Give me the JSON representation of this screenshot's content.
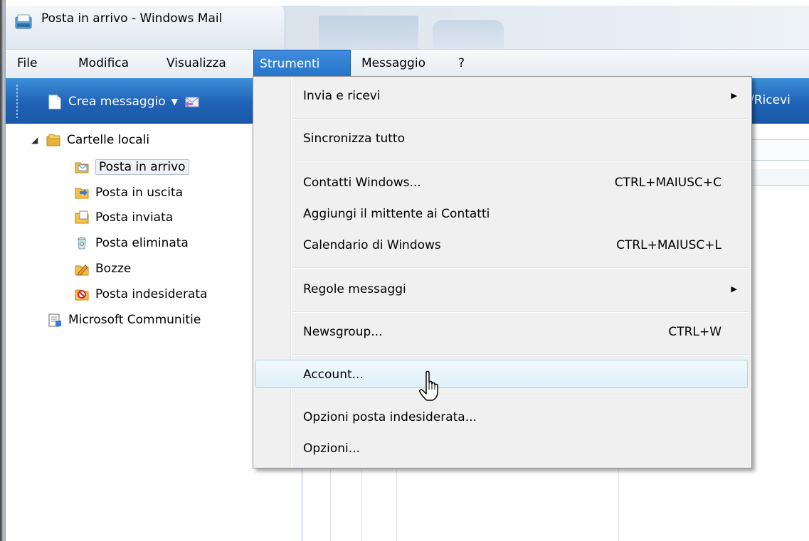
{
  "window": {
    "title": "Posta in arrivo - Windows Mail"
  },
  "menubar": {
    "items": [
      "File",
      "Modifica",
      "Visualizza",
      "Strumenti",
      "Messaggio",
      "?"
    ],
    "active": "Strumenti"
  },
  "toolbar": {
    "new_message": "Crea messaggio",
    "send_receive_partial": "/Ricevi"
  },
  "folders": {
    "root": "Cartelle locali",
    "items": [
      "Posta in arrivo",
      "Posta in uscita",
      "Posta inviata",
      "Posta eliminata",
      "Bozze",
      "Posta indesiderata"
    ],
    "communities": "Microsoft Communitie",
    "selected": "Posta in arrivo"
  },
  "tools_menu": {
    "items": [
      {
        "label": "Invia e ricevi",
        "submenu": true
      },
      {
        "label": "Sincronizza tutto"
      },
      {
        "label": "Contatti Windows...",
        "shortcut": "CTRL+MAIUSC+C"
      },
      {
        "label": "Aggiungi il mittente ai Contatti"
      },
      {
        "label": "Calendario di Windows",
        "shortcut": "CTRL+MAIUSC+L"
      },
      {
        "label": "Regole messaggi",
        "submenu": true
      },
      {
        "label": "Newsgroup...",
        "shortcut": "CTRL+W"
      },
      {
        "label": "Account...",
        "highlighted": true
      },
      {
        "label": "Opzioni posta indesiderata..."
      },
      {
        "label": "Opzioni..."
      }
    ]
  },
  "colors": {
    "toolbar": "#2a6fc0",
    "menu_active": "#2f7ed6",
    "menu_highlight": "#dff0fa"
  }
}
